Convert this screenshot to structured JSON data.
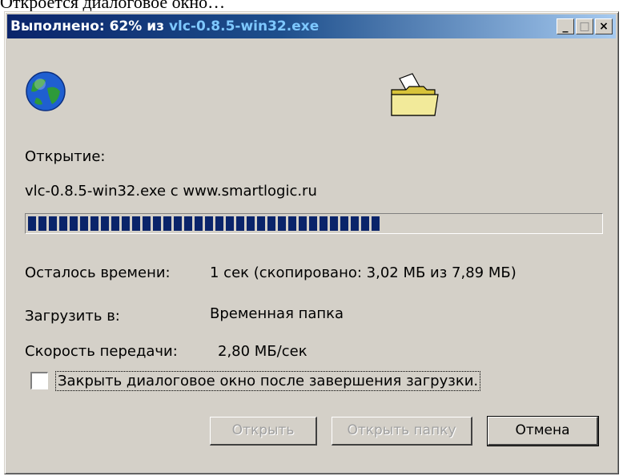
{
  "caption": "Откроется диалоговое окно…",
  "window": {
    "title_prefix": "Выполнено: 62% из ",
    "title_file": "vlc-0.8.5-win32.exe",
    "controls": {
      "minimize": "_",
      "maximize": "□",
      "close": "×"
    }
  },
  "icons": {
    "left": "globe-icon",
    "right": "folder-icon"
  },
  "opening_label": "Открытие:",
  "file_source": "vlc-0.8.5-win32.exe с www.smartlogic.ru",
  "progress": {
    "percent": 62
  },
  "rows": {
    "time_left_label": "Осталось времени:",
    "time_left_value": "1 сек (скопировано: 3,02 МБ из 7,89 МБ)",
    "download_to_label": "Загрузить в:",
    "download_to_value": "Временная папка",
    "speed_label": "Скорость передачи:",
    "speed_value": "2,80 МБ/сек"
  },
  "close_checkbox": {
    "label": "Закрыть диалоговое окно после завершения загрузки.",
    "checked": false
  },
  "buttons": {
    "open": "Открыть",
    "open_folder": "Открыть папку",
    "cancel": "Отмена"
  },
  "colors": {
    "title_start": "#0a246a",
    "title_end": "#a6caf0",
    "progress": "#0a246a",
    "face": "#d4d0c8"
  }
}
